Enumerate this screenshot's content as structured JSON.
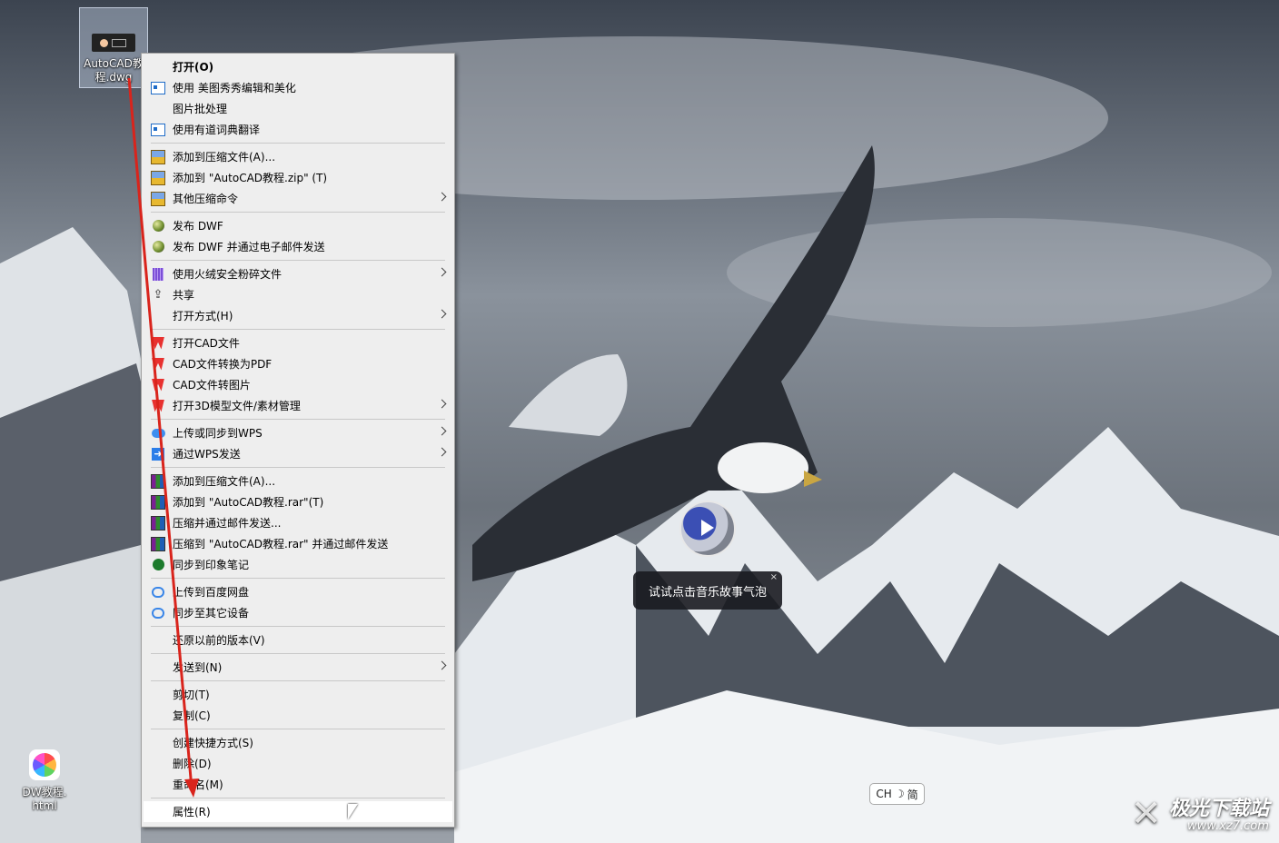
{
  "desktop": {
    "icons": [
      {
        "label_line1": "AutoCAD教",
        "label_line2": "程.dwg"
      },
      {
        "label_line1": "DW教程.",
        "label_line2": "html"
      }
    ]
  },
  "context_menu": {
    "items": [
      {
        "label": "打开(O)",
        "icon": "none"
      },
      {
        "label": "使用 美图秀秀编辑和美化",
        "icon": "picture-icon"
      },
      {
        "label": "图片批处理",
        "icon": "none"
      },
      {
        "label": "使用有道词典翻译",
        "icon": "picture-icon"
      },
      {
        "label": "添加到压缩文件(A)...",
        "icon": "archive-icon"
      },
      {
        "label": "添加到 \"AutoCAD教程.zip\" (T)",
        "icon": "archive-icon"
      },
      {
        "label": "其他压缩命令",
        "icon": "archive-icon"
      },
      {
        "label": "发布 DWF",
        "icon": "globe-icon"
      },
      {
        "label": "发布 DWF 并通过电子邮件发送",
        "icon": "globe-icon"
      },
      {
        "label": "使用火绒安全粉碎文件",
        "icon": "shredder-icon"
      },
      {
        "label": "共享",
        "icon": "share-icon"
      },
      {
        "label": "打开方式(H)",
        "icon": "none"
      },
      {
        "label": "打开CAD文件",
        "icon": "wps-icon"
      },
      {
        "label": "CAD文件转换为PDF",
        "icon": "wps-icon"
      },
      {
        "label": "CAD文件转图片",
        "icon": "wps-icon"
      },
      {
        "label": "打开3D模型文件/素材管理",
        "icon": "wps-icon"
      },
      {
        "label": "上传或同步到WPS",
        "icon": "cloud-upload-icon"
      },
      {
        "label": "通过WPS发送",
        "icon": "send-icon"
      },
      {
        "label": "添加到压缩文件(A)...",
        "icon": "winrar-icon"
      },
      {
        "label": "添加到 \"AutoCAD教程.rar\"(T)",
        "icon": "winrar-icon"
      },
      {
        "label": "压缩并通过邮件发送...",
        "icon": "winrar-icon"
      },
      {
        "label": "压缩到 \"AutoCAD教程.rar\" 并通过邮件发送",
        "icon": "winrar-icon"
      },
      {
        "label": "同步到印象笔记",
        "icon": "evernote-icon"
      },
      {
        "label": "上传到百度网盘",
        "icon": "baidu-netdisk-icon"
      },
      {
        "label": "同步至其它设备",
        "icon": "baidu-netdisk-icon"
      },
      {
        "label": "还原以前的版本(V)",
        "icon": "none"
      },
      {
        "label": "发送到(N)",
        "icon": "none"
      },
      {
        "label": "剪切(T)",
        "icon": "none"
      },
      {
        "label": "复制(C)",
        "icon": "none"
      },
      {
        "label": "创建快捷方式(S)",
        "icon": "none"
      },
      {
        "label": "删除(D)",
        "icon": "none"
      },
      {
        "label": "重命名(M)",
        "icon": "none"
      },
      {
        "label": "属性(R)",
        "icon": "none"
      }
    ]
  },
  "music_bubble": {
    "text": "试试点击音乐故事气泡",
    "close": "×"
  },
  "ime_indicator": {
    "lang": "CH",
    "moon": "☽",
    "mode": "简"
  },
  "watermark": {
    "name": "极光下载站",
    "url": "www.xz7.com"
  },
  "colors": {
    "menu_bg": "#eeeeee",
    "menu_hover": "#ffffff",
    "annotation_arrow": "#d9241c"
  }
}
